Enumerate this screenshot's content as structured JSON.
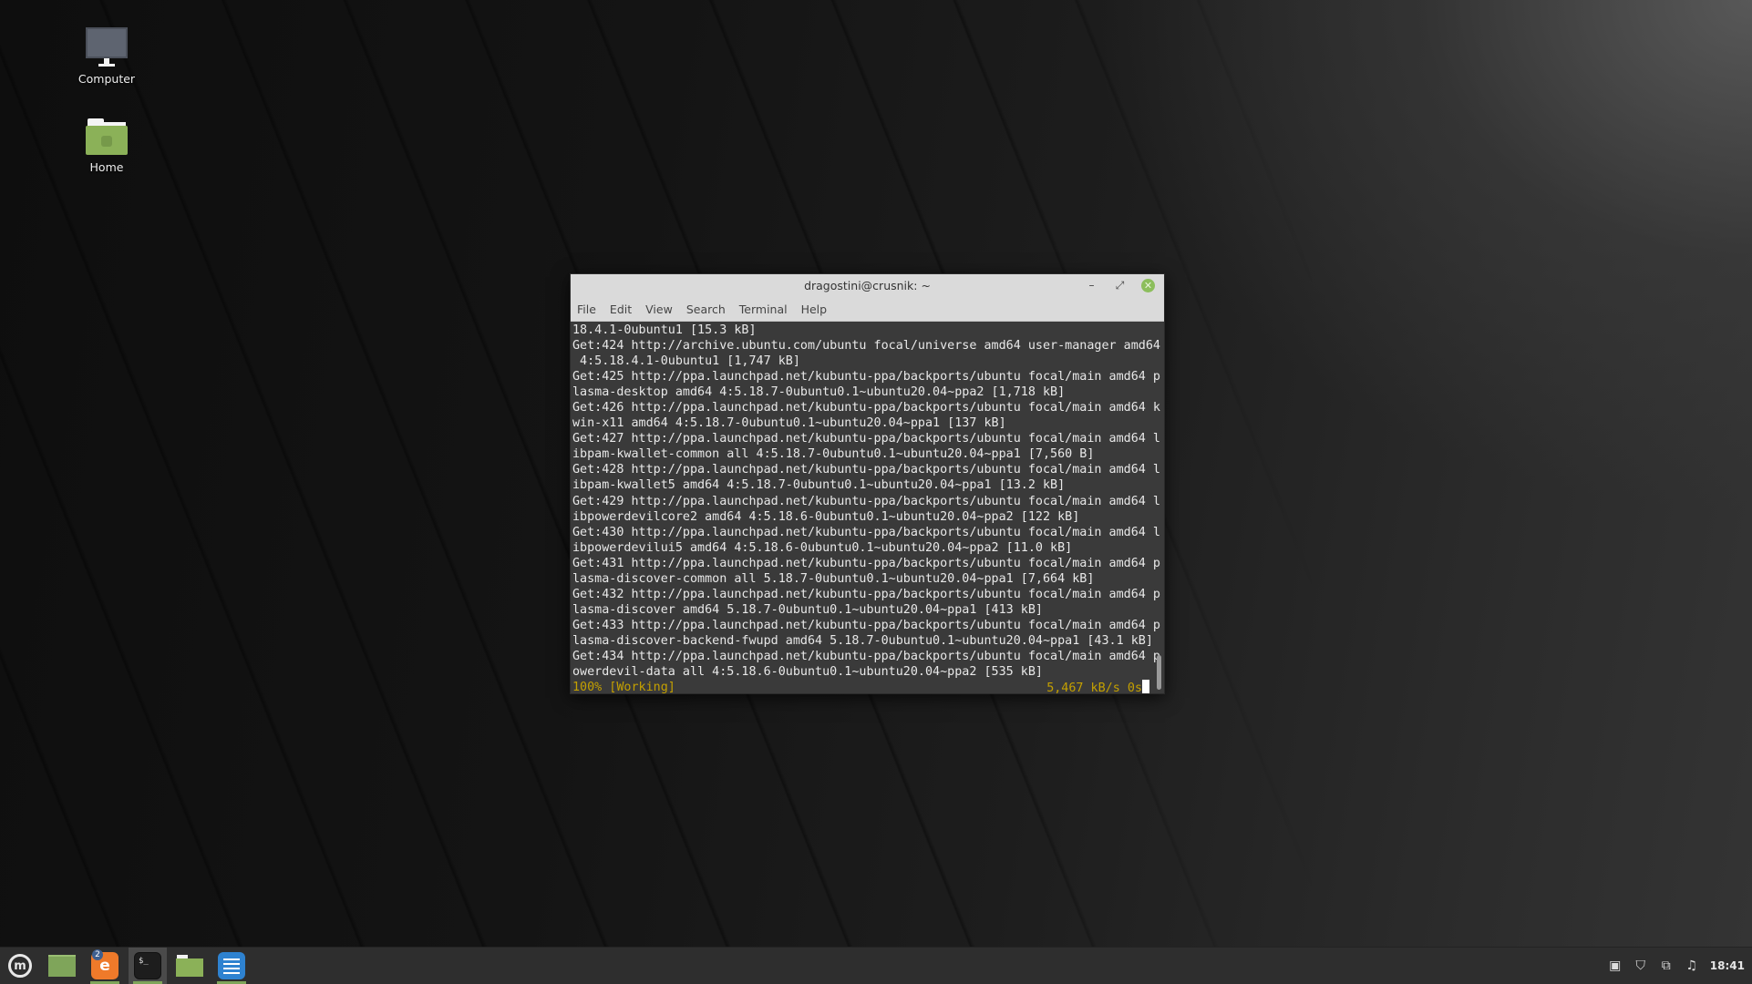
{
  "desktop": {
    "icons": [
      {
        "label": "Computer",
        "icon": "computer-icon"
      },
      {
        "label": "Home",
        "icon": "home-folder-icon"
      }
    ]
  },
  "terminal": {
    "title": "dragostini@crusnik: ~",
    "window_buttons": {
      "minimize": "–",
      "maximize": "⤢",
      "close": "✕"
    },
    "menu": [
      "File",
      "Edit",
      "View",
      "Search",
      "Terminal",
      "Help"
    ],
    "lines": [
      "18.4.1-0ubuntu1 [15.3 kB]",
      "Get:424 http://archive.ubuntu.com/ubuntu focal/universe amd64 user-manager amd64",
      " 4:5.18.4.1-0ubuntu1 [1,747 kB]",
      "Get:425 http://ppa.launchpad.net/kubuntu-ppa/backports/ubuntu focal/main amd64 p",
      "lasma-desktop amd64 4:5.18.7-0ubuntu0.1~ubuntu20.04~ppa2 [1,718 kB]",
      "Get:426 http://ppa.launchpad.net/kubuntu-ppa/backports/ubuntu focal/main amd64 k",
      "win-x11 amd64 4:5.18.7-0ubuntu0.1~ubuntu20.04~ppa1 [137 kB]",
      "Get:427 http://ppa.launchpad.net/kubuntu-ppa/backports/ubuntu focal/main amd64 l",
      "ibpam-kwallet-common all 4:5.18.7-0ubuntu0.1~ubuntu20.04~ppa1 [7,560 B]",
      "Get:428 http://ppa.launchpad.net/kubuntu-ppa/backports/ubuntu focal/main amd64 l",
      "ibpam-kwallet5 amd64 4:5.18.7-0ubuntu0.1~ubuntu20.04~ppa1 [13.2 kB]",
      "Get:429 http://ppa.launchpad.net/kubuntu-ppa/backports/ubuntu focal/main amd64 l",
      "ibpowerdevilcore2 amd64 4:5.18.6-0ubuntu0.1~ubuntu20.04~ppa2 [122 kB]",
      "Get:430 http://ppa.launchpad.net/kubuntu-ppa/backports/ubuntu focal/main amd64 l",
      "ibpowerdevilui5 amd64 4:5.18.6-0ubuntu0.1~ubuntu20.04~ppa2 [11.0 kB]",
      "Get:431 http://ppa.launchpad.net/kubuntu-ppa/backports/ubuntu focal/main amd64 p",
      "lasma-discover-common all 5.18.7-0ubuntu0.1~ubuntu20.04~ppa1 [7,664 kB]",
      "Get:432 http://ppa.launchpad.net/kubuntu-ppa/backports/ubuntu focal/main amd64 p",
      "lasma-discover amd64 5.18.7-0ubuntu0.1~ubuntu20.04~ppa1 [413 kB]",
      "Get:433 http://ppa.launchpad.net/kubuntu-ppa/backports/ubuntu focal/main amd64 p",
      "lasma-discover-backend-fwupd amd64 5.18.7-0ubuntu0.1~ubuntu20.04~ppa1 [43.1 kB]",
      "Get:434 http://ppa.launchpad.net/kubuntu-ppa/backports/ubuntu focal/main amd64 p",
      "owerdevil-data all 4:5.18.6-0ubuntu0.1~ubuntu20.04~ppa2 [535 kB]"
    ],
    "status_left": "100% [Working]",
    "status_right": "5,467 kB/s 0s",
    "colors": {
      "background": "#3a3a3a",
      "foreground": "#e8e8e8",
      "status": "#c4a000"
    }
  },
  "taskbar": {
    "menu_label": "m",
    "firefox_badge": "2",
    "firefox_glyph": "e",
    "terminal_glyph": "$_",
    "tray": {
      "update_icon": "▣",
      "shield_icon": "⛉",
      "network_icon": "⧉",
      "sound_icon": "♫",
      "clock": "18:41"
    },
    "accent": "#7fa55a"
  }
}
